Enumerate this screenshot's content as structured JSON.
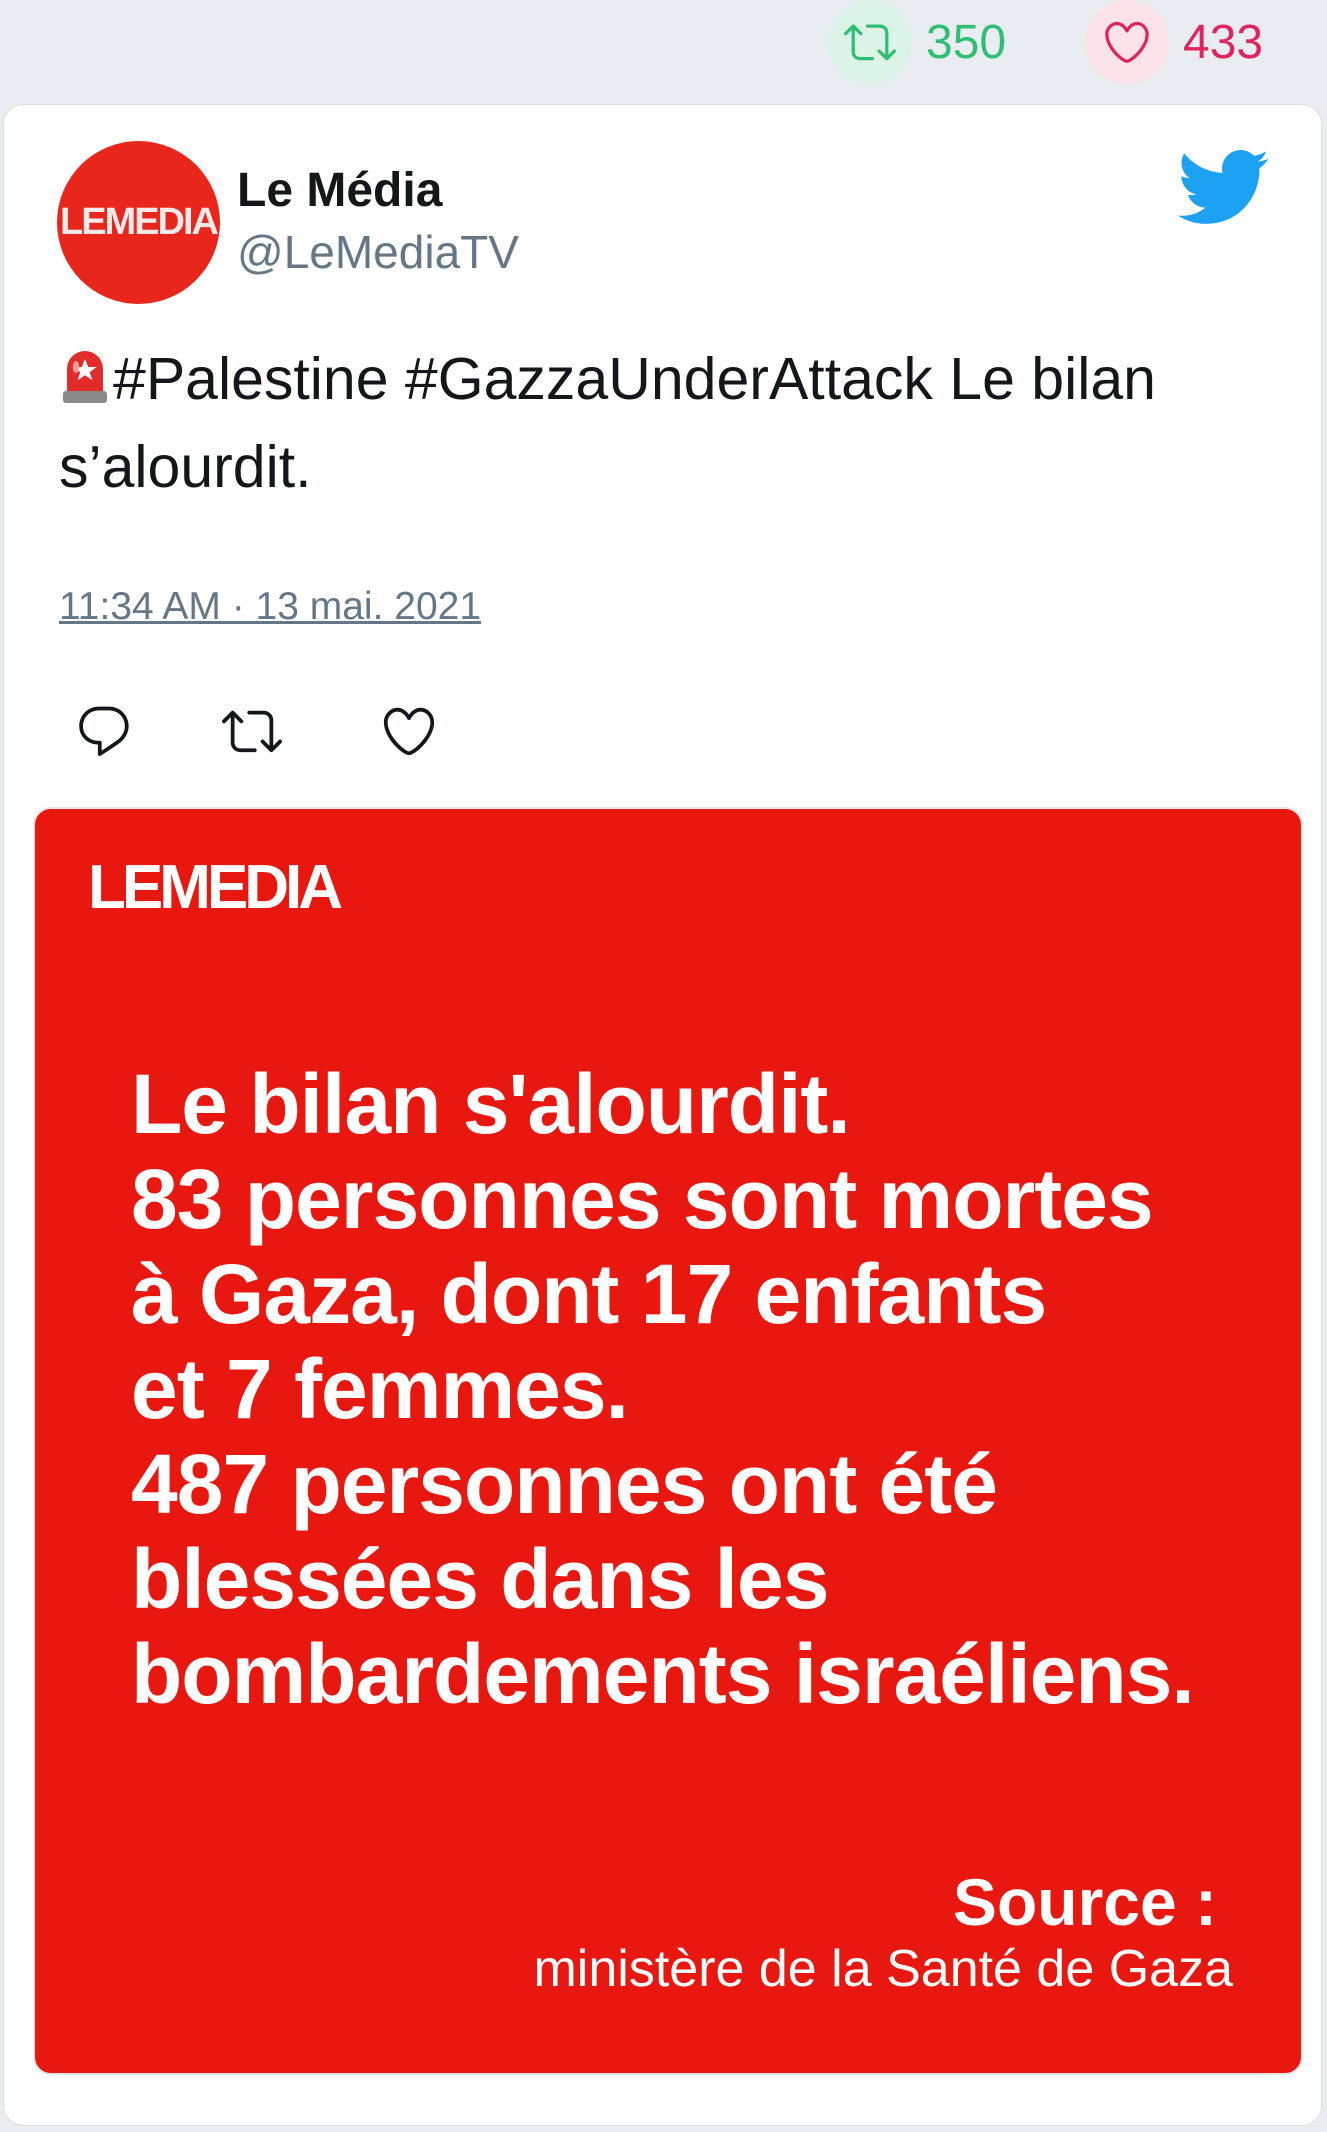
{
  "stats": {
    "retweets": "350",
    "likes": "433",
    "colors": {
      "retweet": "#2fbf73",
      "like": "#e0245e"
    }
  },
  "tweet": {
    "author_name": "Le Média",
    "author_handle": "@LeMediaTV",
    "avatar_logo": "LEMEDIA",
    "text": "#Palestine #GazzaUnderAttack Le bilan s’alourdit.",
    "timestamp": "11:34 AM · 13 mai. 2021",
    "icons": [
      "siren-icon",
      "twitter-bird-icon",
      "reply-icon",
      "retweet-icon",
      "like-icon"
    ]
  },
  "media": {
    "logo": "LEMEDIA",
    "lines": [
      "Le bilan s'alourdit.",
      "83 personnes sont mortes",
      "à Gaza, dont 17 enfants",
      "et 7 femmes.",
      "487 personnes ont été",
      "blessées dans les",
      "bombardements israéliens."
    ],
    "source_title": "Source :",
    "source_body": "ministère de la Santé de Gaza",
    "background": "#e8170f"
  }
}
